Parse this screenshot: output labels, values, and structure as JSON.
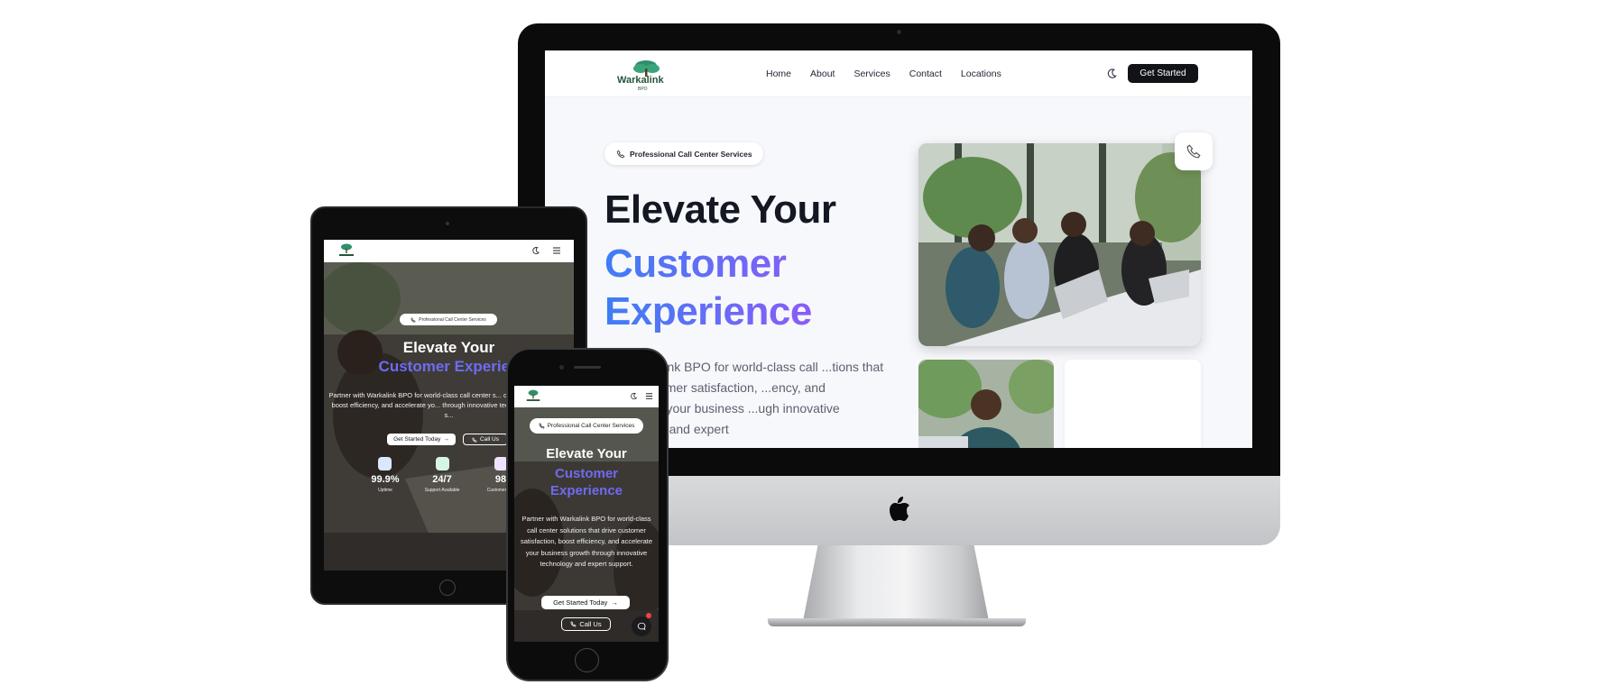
{
  "desktop": {
    "logo": {
      "name": "Warkalink",
      "sub": "BPO"
    },
    "nav": {
      "links": [
        "Home",
        "About",
        "Services",
        "Contact",
        "Locations"
      ],
      "cta": "Get Started"
    },
    "hero": {
      "badge": "Professional Call Center Services",
      "title_line1": "Elevate Your",
      "title_line2": "Customer",
      "title_line3": "Experience",
      "paragraph": "...n Warkalink BPO for world-class call ...tions that drive customer satisfaction, ...ency, and accelerate your business ...ugh innovative technology and expert"
    },
    "colors": {
      "accent_start": "#3d7ef5",
      "accent_end": "#8b5cf6",
      "cta_bg": "#111318"
    }
  },
  "tablet": {
    "logo": {
      "name": "Warkalink",
      "sub": "BPO"
    },
    "hero": {
      "badge": "Professional Call Center Services",
      "title_line1": "Elevate Your",
      "title_line2": "Customer Experien",
      "paragraph": "Partner with Warkalink BPO for world-class call center s... customer satisfaction, boost efficiency, and accelerate yo... through innovative technology and expert s...",
      "btn_primary": "Get Started Today",
      "btn_secondary": "Call Us"
    },
    "stats": [
      {
        "value": "99.9%",
        "label": "Uptime",
        "icon": "users-icon"
      },
      {
        "value": "24/7",
        "label": "Support Available",
        "icon": "headset-icon"
      },
      {
        "value": "98",
        "label": "Customer S...",
        "icon": "smile-icon"
      }
    ]
  },
  "phone": {
    "logo": {
      "name": "Warkalink",
      "sub": "BPO"
    },
    "hero": {
      "badge": "Professional Call Center Services",
      "title_line1": "Elevate Your",
      "title_line2": "Customer",
      "title_line3": "Experience",
      "paragraph": "Partner with Warkalink BPO for world-class call center solutions that drive customer satisfaction, boost efficiency, and accelerate your business growth through innovative technology and expert support.",
      "btn_primary": "Get Started Today",
      "btn_secondary": "Call Us"
    }
  }
}
